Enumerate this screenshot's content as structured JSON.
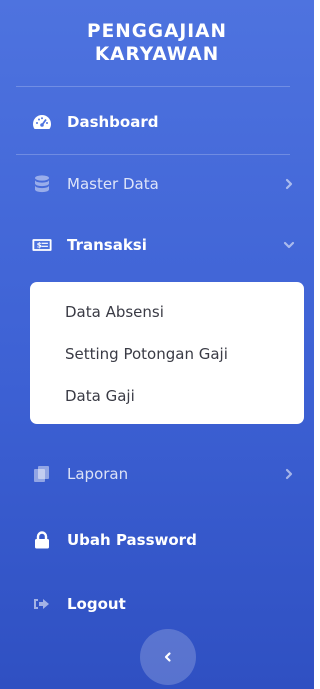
{
  "brand": {
    "line1": "PENGGAJIAN",
    "line2": "KARYAWAN"
  },
  "nav": {
    "dashboard": {
      "label": "Dashboard",
      "icon": "tachometer-icon"
    },
    "master_data": {
      "label": "Master Data",
      "icon": "database-icon"
    },
    "transaksi": {
      "label": "Transaksi",
      "icon": "money-bill-icon",
      "expanded": true,
      "subitems": [
        "Data Absensi",
        "Setting Potongan Gaji",
        "Data Gaji"
      ]
    },
    "laporan": {
      "label": "Laporan",
      "icon": "copy-icon"
    },
    "ubah_password": {
      "label": "Ubah Password",
      "icon": "lock-icon"
    },
    "logout": {
      "label": "Logout",
      "icon": "sign-out-icon"
    }
  },
  "colors": {
    "sidebar_top": "#4e73df",
    "sidebar_bottom": "#2f50c2",
    "submenu_bg": "#ffffff",
    "submenu_text": "#3a3b45"
  }
}
